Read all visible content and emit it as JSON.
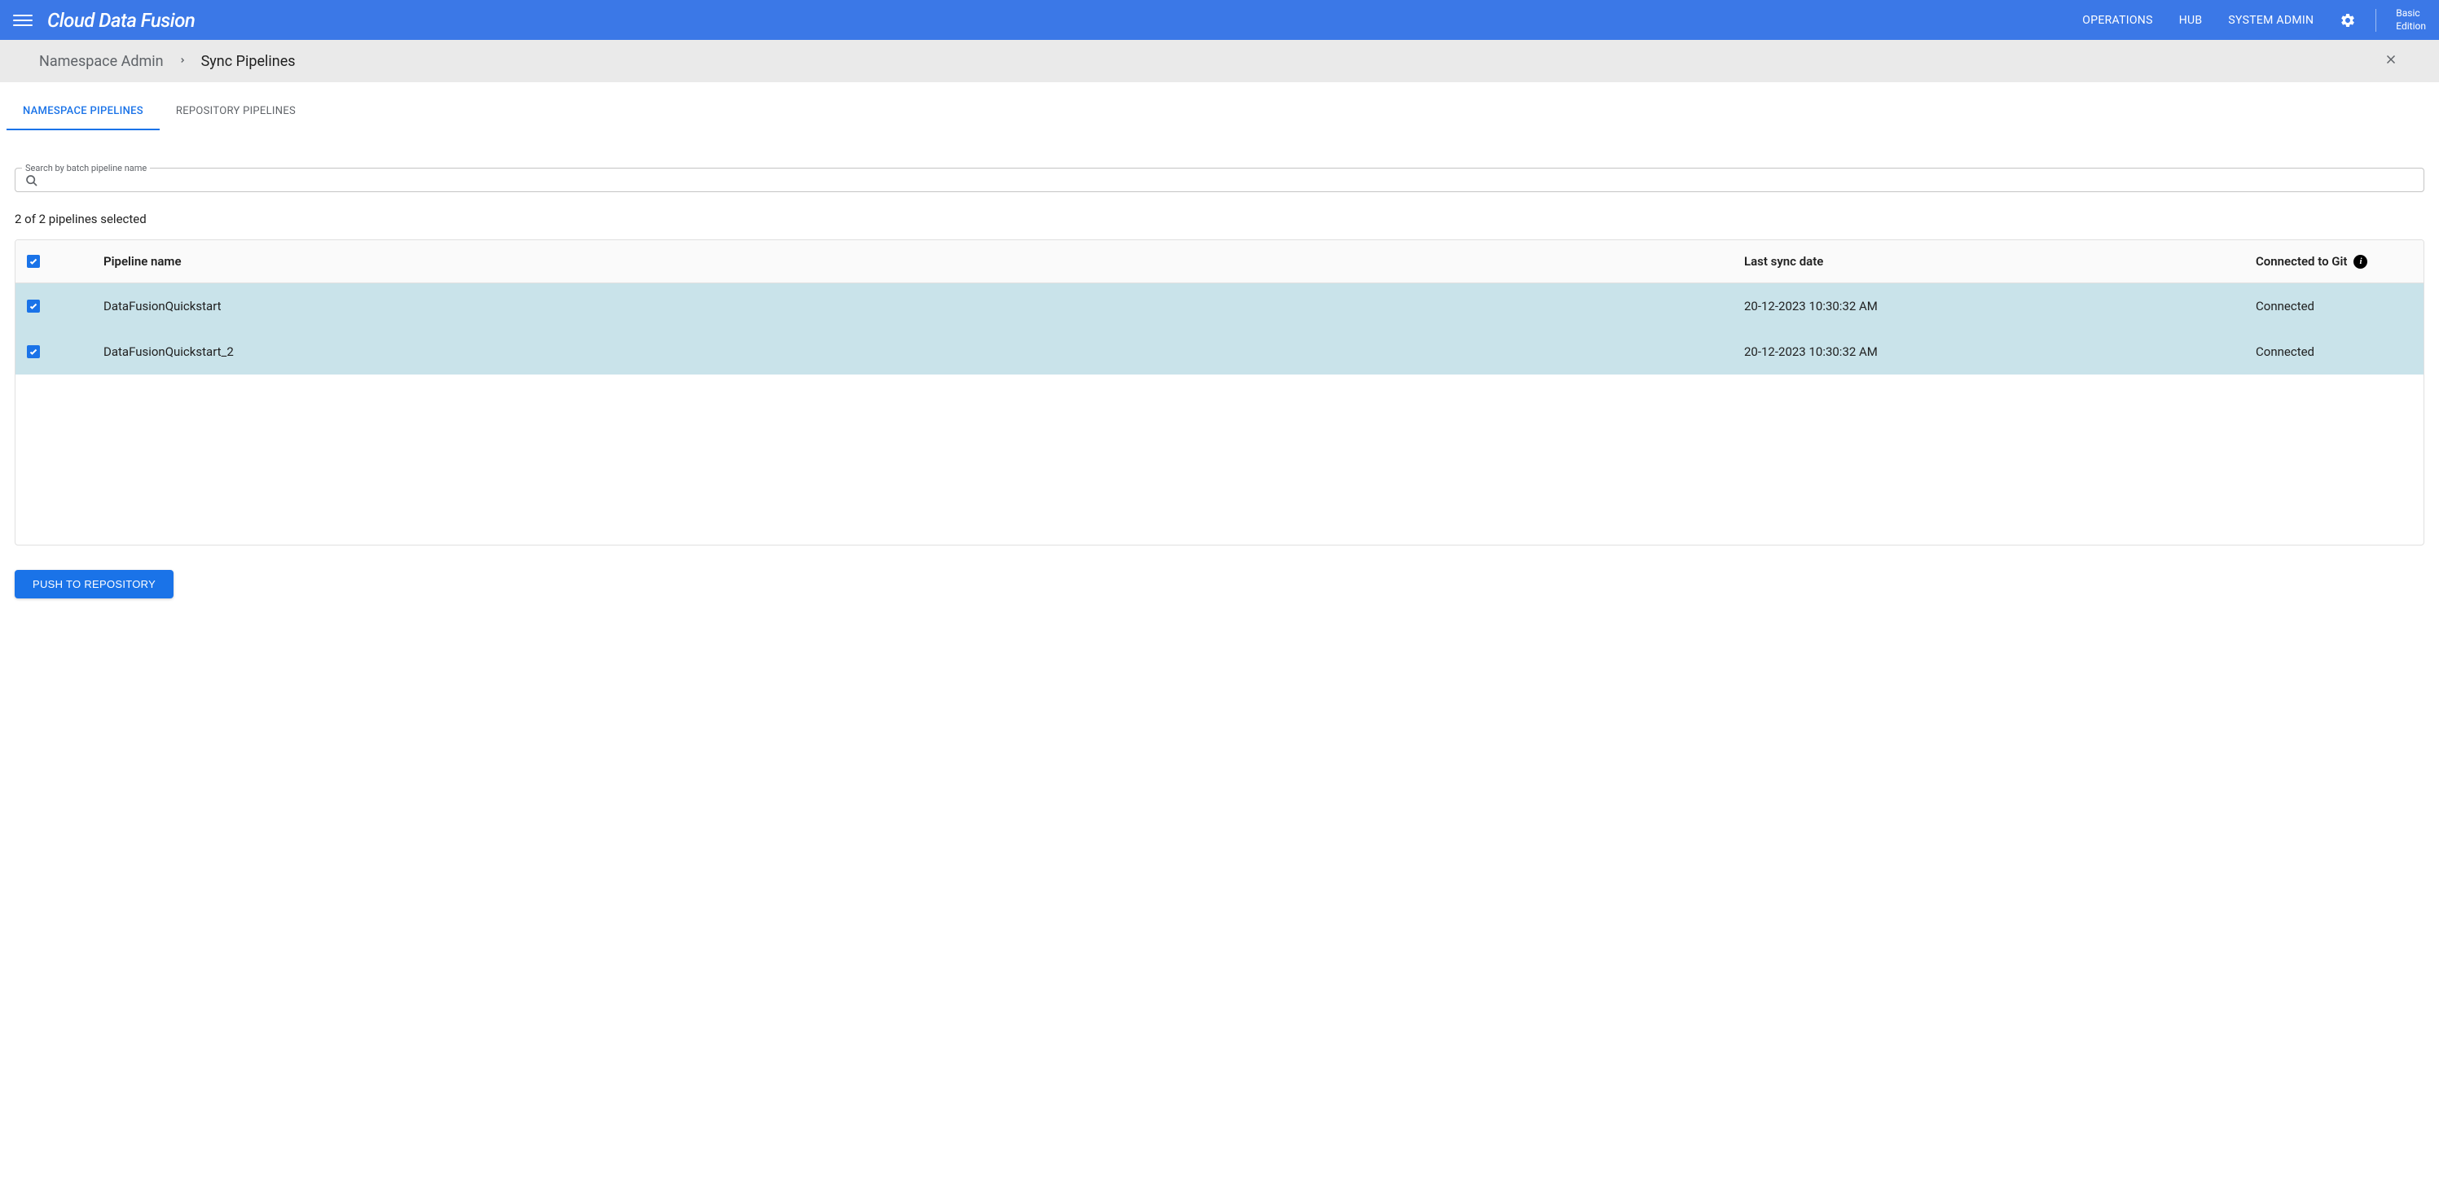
{
  "header": {
    "product_name": "Cloud Data Fusion",
    "nav": {
      "operations": "OPERATIONS",
      "hub": "HUB",
      "system_admin": "SYSTEM ADMIN"
    },
    "edition_line1": "Basic",
    "edition_line2": "Edition"
  },
  "breadcrumb": {
    "root": "Namespace Admin",
    "current": "Sync Pipelines"
  },
  "tabs": {
    "namespace": "NAMESPACE PIPELINES",
    "repository": "REPOSITORY PIPELINES"
  },
  "search": {
    "label": "Search by batch pipeline name",
    "value": ""
  },
  "selection_text": "2 of 2 pipelines selected",
  "table": {
    "headers": {
      "pipeline_name": "Pipeline name",
      "last_sync": "Last sync date",
      "connected": "Connected to Git"
    },
    "rows": [
      {
        "name": "DataFusionQuickstart",
        "sync_date": "20-12-2023 10:30:32 AM",
        "status": "Connected",
        "selected": true
      },
      {
        "name": "DataFusionQuickstart_2",
        "sync_date": "20-12-2023 10:30:32 AM",
        "status": "Connected",
        "selected": true
      }
    ]
  },
  "actions": {
    "push_button": "PUSH TO REPOSITORY"
  }
}
